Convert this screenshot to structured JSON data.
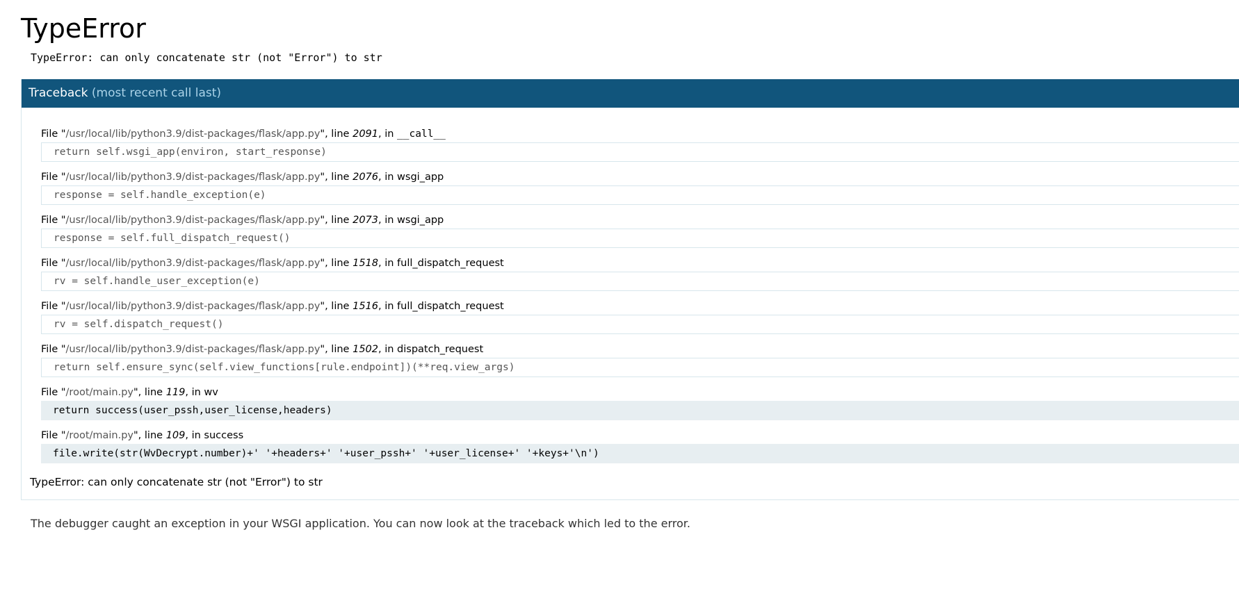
{
  "error": {
    "title": "TypeError",
    "message": "TypeError: can only concatenate str (not \"Error\") to str"
  },
  "traceback": {
    "header_title": "Traceback",
    "header_hint": "(most recent call last)",
    "frames": [
      {
        "file_prefix": "File \"",
        "path": "/usr/local/lib/python3.9/dist-packages/flask/app.py",
        "line_label": "\", line ",
        "lineno": "2091",
        "in_label": ", in ",
        "function": "__call__",
        "source": "return self.wsgi_app(environ, start_response)"
      },
      {
        "file_prefix": "File \"",
        "path": "/usr/local/lib/python3.9/dist-packages/flask/app.py",
        "line_label": "\", line ",
        "lineno": "2076",
        "in_label": ", in ",
        "function": "wsgi_app",
        "source": "response = self.handle_exception(e)"
      },
      {
        "file_prefix": "File \"",
        "path": "/usr/local/lib/python3.9/dist-packages/flask/app.py",
        "line_label": "\", line ",
        "lineno": "2073",
        "in_label": ", in ",
        "function": "wsgi_app",
        "source": "response = self.full_dispatch_request()"
      },
      {
        "file_prefix": "File \"",
        "path": "/usr/local/lib/python3.9/dist-packages/flask/app.py",
        "line_label": "\", line ",
        "lineno": "1518",
        "in_label": ", in ",
        "function": "full_dispatch_request",
        "source": "rv = self.handle_user_exception(e)"
      },
      {
        "file_prefix": "File \"",
        "path": "/usr/local/lib/python3.9/dist-packages/flask/app.py",
        "line_label": "\", line ",
        "lineno": "1516",
        "in_label": ", in ",
        "function": "full_dispatch_request",
        "source": "rv = self.dispatch_request()"
      },
      {
        "file_prefix": "File \"",
        "path": "/usr/local/lib/python3.9/dist-packages/flask/app.py",
        "line_label": "\", line ",
        "lineno": "1502",
        "in_label": ", in ",
        "function": "dispatch_request",
        "source": "return self.ensure_sync(self.view_functions[rule.endpoint])(**req.view_args)"
      },
      {
        "file_prefix": "File \"",
        "path": "/root/main.py",
        "line_label": "\", line ",
        "lineno": "119",
        "in_label": ", in ",
        "function": "wv",
        "source": "return success(user_pssh,user_license,headers)"
      },
      {
        "file_prefix": "File \"",
        "path": "/root/main.py",
        "line_label": "\", line ",
        "lineno": "109",
        "in_label": ", in ",
        "function": "success",
        "source": "file.write(str(WvDecrypt.number)+' '+headers+' '+user_pssh+' '+user_license+' '+keys+'\\n')"
      }
    ],
    "footer": "TypeError: can only concatenate str (not \"Error\") to str"
  },
  "explanation": "The debugger caught an exception in your WSGI application. You can now look at the traceback which led to the error.",
  "colors": {
    "header_bg": "#11557c",
    "header_hint": "#aad3e8",
    "current_source_bg": "#e7eef1",
    "border": "#d7e6ec"
  }
}
